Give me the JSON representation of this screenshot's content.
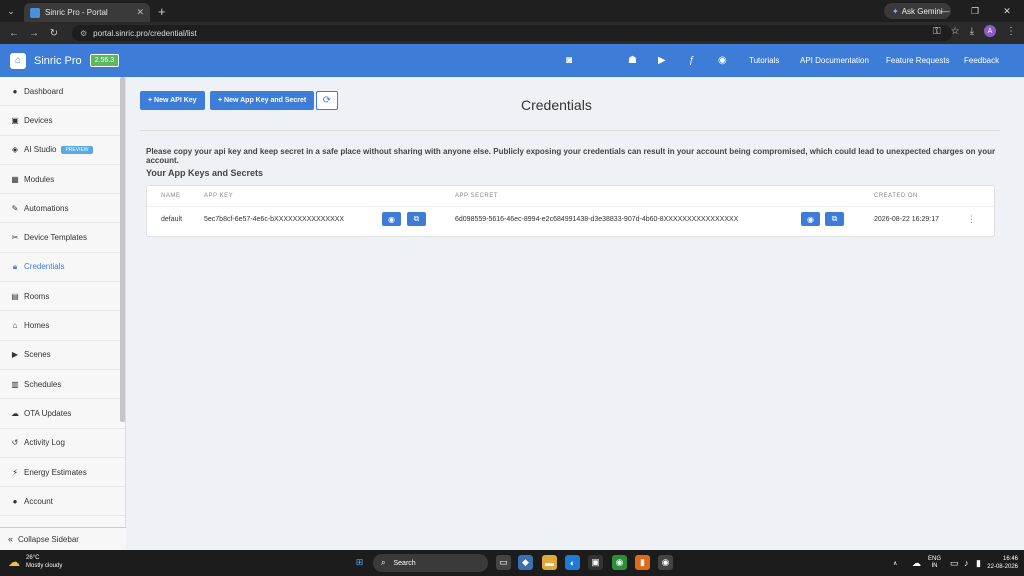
{
  "browser": {
    "tab_title": "Sinric Pro - Portal",
    "new_tab": "+",
    "gemini_label": "Ask Gemini",
    "url": "portal.sinric.pro/credential/list"
  },
  "topbar": {
    "brand": "Sinric Pro",
    "version": "2.56.3",
    "social_icons": [
      "discord-icon",
      "apple-icon",
      "android-icon",
      "youtube-icon",
      "facebook-icon",
      "github-icon"
    ],
    "nav": [
      "Tutorials",
      "API Documentation",
      "Feature Requests",
      "Feedback"
    ]
  },
  "sidebar": {
    "items": [
      {
        "label": "Dashboard",
        "icon": "info-icon"
      },
      {
        "label": "Devices",
        "icon": "device-icon"
      },
      {
        "label": "AI Studio",
        "icon": "ai-icon",
        "badge": "PREVIEW"
      },
      {
        "label": "Modules",
        "icon": "grid-icon"
      },
      {
        "label": "Automations",
        "icon": "wrench-icon"
      },
      {
        "label": "Device Templates",
        "icon": "template-icon"
      },
      {
        "label": "Credentials",
        "icon": "lock-icon",
        "active": true
      },
      {
        "label": "Rooms",
        "icon": "rooms-icon"
      },
      {
        "label": "Homes",
        "icon": "home-icon"
      },
      {
        "label": "Scenes",
        "icon": "play-icon"
      },
      {
        "label": "Schedules",
        "icon": "calendar-icon"
      },
      {
        "label": "OTA Updates",
        "icon": "cloud-upload-icon"
      },
      {
        "label": "Activity Log",
        "icon": "history-icon"
      },
      {
        "label": "Energy Estimates",
        "icon": "bolt-icon"
      },
      {
        "label": "Account",
        "icon": "user-icon"
      }
    ],
    "collapse_label": "Collapse Sidebar"
  },
  "main": {
    "new_api_key": "+ New API Key",
    "new_app_key": "+ New App Key and Secret",
    "title": "Credentials",
    "notice": "Please copy your api key and keep secret in a safe place without sharing with anyone else. Publicly exposing your credentials can result in your account being compromised, which could lead to unexpected charges on your account.",
    "subtitle": "Your App Keys and Secrets",
    "columns": [
      "NAME",
      "APP KEY",
      "APP SECRET",
      "CREATED ON"
    ],
    "rows": [
      {
        "name": "default",
        "app_key": "5ec7b8cf-6e57-4e6c-bXXXXXXXXXXXXXXX",
        "app_secret": "6d098559-5616-46ec-8994-e2c684991438-d3e38833-907d-4b60-8XXXXXXXXXXXXXXXX",
        "created_on": "2026-08-22 16:29:17"
      }
    ]
  },
  "taskbar": {
    "temp": "26°C",
    "weather": "Mostly cloudy",
    "search": "Search",
    "lang1": "ENG",
    "lang2": "IN",
    "time": "16:46",
    "date": "22-08-2026"
  },
  "colors": {
    "accent": "#3d7dd8",
    "version_badge": "#5cb85c",
    "preview_badge": "#5aa7e6"
  }
}
